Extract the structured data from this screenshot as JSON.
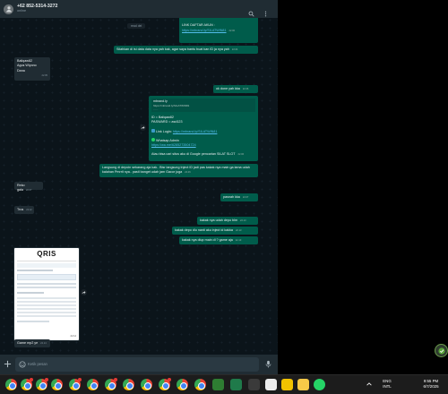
{
  "header": {
    "title": "+62 852-5314-3272",
    "subtitle": "online"
  },
  "messages": {
    "m0_line1": "Nomor HP",
    "m0_line2": "LINK DAFTAR AKUN :",
    "m0_link": "https://mbrand.ly/SILATWIN81",
    "m0_time": "22.00",
    "sys_label": "read del",
    "m1_text": "Silahkan di isi data data nya yah kak, agar saya bantu buat kan ID ja nya yah",
    "m1_time": "22.04",
    "m2_line1": "Baliqaw82",
    "m2_line2": "Agus Wiyono",
    "m2_line3": "Dana",
    "m2_time": "22.05",
    "m3_text": "ok done yah kka",
    "m3_time": "22.06",
    "m4_domain": "mbrand.ly",
    "m4_link_top": "https://mbrand.ly/SILATWIN81",
    "m4_id": "ID = Baliqaw82",
    "m4_pw": "PASWARD = asd123",
    "m4_login_label": "Link Login:",
    "m4_login_link": "https://mbrand.ly/SILATWIN81",
    "m4_wa_label": "Whatsap Admin",
    "m4_wa_link": "https://wa.me/6285273504724",
    "m4_note": "Atau bisa cari situs aku di Google pencarian SILAT SLOT",
    "m4_time": "22.06",
    "m5_text": "Langsung di depoin sekarang aja kak.. Bisr langsung Inject ID jadi pas kakak nya main ga lama udah kalahan Pmrrit nya.. pasti banget udah jam Gacor juga",
    "m5_time": "22.06",
    "m6_text": "Reko gala",
    "m6_time": "22.07",
    "m7_text": "pasnah kka",
    "m7_time": "22.07",
    "m8_text": "Trus",
    "m8_time": "22.12",
    "m9_text": "kakak nya udah depo blm",
    "m9_time": "22.13",
    "m10_text": "kakak depo dlu nanti aku inject id kakka",
    "m10_time": "22.13",
    "m11_text": "kakak nya diup main  di ? game aja",
    "m11_time": "22.13",
    "img_title": "QRIS",
    "img_time": "22.14",
    "m12_text": "Game mp2 ye",
    "m12_time": "22.14"
  },
  "footer": {
    "placeholder": "Ketik pesan"
  },
  "taskbar": {
    "lang1": "ENG",
    "lang2": "INTL",
    "time": "9:55 PM",
    "date": "6/7/2025"
  },
  "colors": {
    "outgoing": "#005c4b",
    "incoming": "#202c33",
    "background": "#0b141a",
    "link": "#53bdeb"
  },
  "icons": [
    "person-icon",
    "search-icon",
    "more-icon",
    "forward-icon",
    "plus-icon",
    "emoji-icon",
    "mic-icon",
    "chrome-icon",
    "notepad-icon",
    "whatsapp-icon",
    "chevron-up-icon"
  ]
}
